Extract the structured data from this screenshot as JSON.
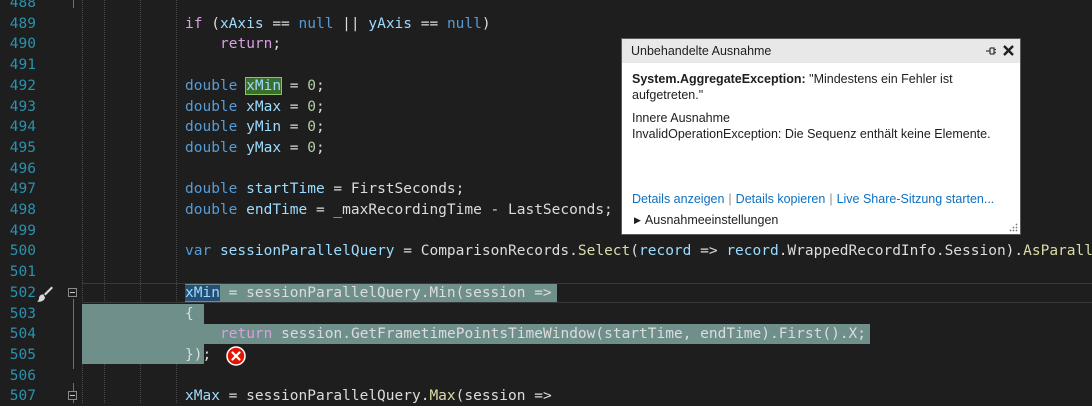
{
  "editor": {
    "lines": [
      {
        "n": "488"
      },
      {
        "n": "489",
        "tokens": [
          [
            "ctl",
            "if"
          ],
          [
            "ident",
            " ("
          ],
          [
            "var",
            "xAxis"
          ],
          [
            "ident",
            " == "
          ],
          [
            "kw",
            "null"
          ],
          [
            "ident",
            " || "
          ],
          [
            "var",
            "yAxis"
          ],
          [
            "ident",
            " == "
          ],
          [
            "kw",
            "null"
          ],
          [
            "ident",
            ")"
          ]
        ]
      },
      {
        "n": "490",
        "indent": 1,
        "tokens": [
          [
            "ctl",
            "return"
          ],
          [
            "ident",
            ";"
          ]
        ]
      },
      {
        "n": "491"
      },
      {
        "n": "492",
        "tokens": [
          [
            "kw",
            "double"
          ],
          [
            "ident",
            " "
          ],
          [
            "var hl-green",
            "xMin"
          ],
          [
            "ident",
            " = "
          ],
          [
            "num",
            "0"
          ],
          [
            "ident",
            ";"
          ]
        ]
      },
      {
        "n": "493",
        "tokens": [
          [
            "kw",
            "double"
          ],
          [
            "ident",
            " "
          ],
          [
            "var",
            "xMax"
          ],
          [
            "ident",
            " = "
          ],
          [
            "num",
            "0"
          ],
          [
            "ident",
            ";"
          ]
        ]
      },
      {
        "n": "494",
        "tokens": [
          [
            "kw",
            "double"
          ],
          [
            "ident",
            " "
          ],
          [
            "var",
            "yMin"
          ],
          [
            "ident",
            " = "
          ],
          [
            "num",
            "0"
          ],
          [
            "ident",
            ";"
          ]
        ]
      },
      {
        "n": "495",
        "tokens": [
          [
            "kw",
            "double"
          ],
          [
            "ident",
            " "
          ],
          [
            "var",
            "yMax"
          ],
          [
            "ident",
            " = "
          ],
          [
            "num",
            "0"
          ],
          [
            "ident",
            ";"
          ]
        ]
      },
      {
        "n": "496"
      },
      {
        "n": "497",
        "tokens": [
          [
            "kw",
            "double"
          ],
          [
            "ident",
            " "
          ],
          [
            "var",
            "startTime"
          ],
          [
            "ident",
            " = FirstSeconds;"
          ]
        ]
      },
      {
        "n": "498",
        "tokens": [
          [
            "kw",
            "double"
          ],
          [
            "ident",
            " "
          ],
          [
            "var",
            "endTime"
          ],
          [
            "ident",
            " = _maxRecordingTime - LastSeconds;"
          ]
        ]
      },
      {
        "n": "499"
      },
      {
        "n": "500",
        "tokens": [
          [
            "kw",
            "var"
          ],
          [
            "ident",
            " "
          ],
          [
            "var",
            "sessionParallelQuery"
          ],
          [
            "ident",
            " = ComparisonRecords."
          ],
          [
            "mth",
            "Select"
          ],
          [
            "ident",
            "("
          ],
          [
            "var",
            "record"
          ],
          [
            "ident",
            " => "
          ],
          [
            "var",
            "record"
          ],
          [
            "ident",
            ".WrappedRecordInfo.Session)."
          ],
          [
            "mth",
            "AsParallel"
          ]
        ]
      },
      {
        "n": "501"
      },
      {
        "n": "502",
        "tokens": [
          [
            "var hl-blue",
            "xMin"
          ],
          [
            "ident",
            " = sessionParallelQuery.Min(session =>"
          ]
        ]
      },
      {
        "n": "503",
        "tokens": [
          [
            "ident",
            "{"
          ]
        ]
      },
      {
        "n": "504",
        "indent": 1,
        "tokens": [
          [
            "ctl",
            "return"
          ],
          [
            "ident",
            " session.GetFrametimePointsTimeWindow(startTime, endTime).First().X;"
          ]
        ]
      },
      {
        "n": "505",
        "tokens": [
          [
            "ident",
            "});"
          ]
        ]
      },
      {
        "n": "506"
      },
      {
        "n": "507",
        "tokens": [
          [
            "var",
            "xMax"
          ],
          [
            "ident",
            " = sessionParallelQuery."
          ],
          [
            "mth",
            "Max"
          ],
          [
            "ident",
            "(session =>"
          ]
        ]
      }
    ],
    "brush_icon": "paintbrush-icon",
    "error_icon": "error-circle-icon",
    "colors": {
      "line_number": "#2b91af",
      "keyword": "#569cd6",
      "selection": "#6f8f8b",
      "error": "#e51400"
    }
  },
  "exception_popup": {
    "title": "Unbehandelte Ausnahme",
    "exception_type": "System.AggregateException:",
    "exception_message": "\"Mindestens ein Fehler ist aufgetreten.\"",
    "inner_heading": "Innere Ausnahme",
    "inner_message": "InvalidOperationException: Die Sequenz enthält keine Elemente.",
    "links": [
      "Details anzeigen",
      "Details kopieren",
      "Live Share-Sitzung starten..."
    ],
    "settings_label": "Ausnahmeeinstellungen",
    "pin_icon": "pin-icon",
    "close_icon": "close-icon"
  }
}
